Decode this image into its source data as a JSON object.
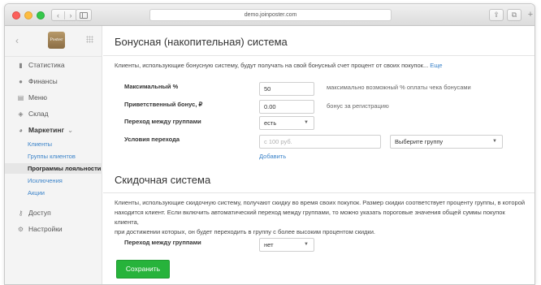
{
  "browser": {
    "url": "demo.joinposter.com",
    "nav_back": "‹",
    "nav_forward": "›",
    "share_glyph": "⇪",
    "tabs_glyph": "⧉",
    "new_tab_glyph": "+"
  },
  "sidebar": {
    "back_glyph": "‹",
    "logo_text": "Poster",
    "items": [
      {
        "label": "Статистика",
        "icon": "bar-chart-icon",
        "glyph": "▮"
      },
      {
        "label": "Финансы",
        "icon": "coin-icon",
        "glyph": "●"
      },
      {
        "label": "Меню",
        "icon": "document-icon",
        "glyph": "▤"
      },
      {
        "label": "Склад",
        "icon": "layers-icon",
        "glyph": "◈"
      },
      {
        "label": "Маркетинг",
        "icon": "pie-chart-icon",
        "glyph": "◕",
        "expanded_glyph": "⌄"
      },
      {
        "label": "Доступ",
        "icon": "key-icon",
        "glyph": "⚷"
      },
      {
        "label": "Настройки",
        "icon": "gear-icon",
        "glyph": "⚙"
      }
    ],
    "submenu": [
      {
        "label": "Клиенты"
      },
      {
        "label": "Группы клиентов"
      },
      {
        "label": "Программы лояльности",
        "active": true
      },
      {
        "label": "Исключения"
      },
      {
        "label": "Акции"
      }
    ]
  },
  "bonus": {
    "title": "Бонусная (накопительная) система",
    "description": "Клиенты, использующие бонусную систему, будут получать на свой бонусный счет процент от своих покупок...",
    "more_link": "Еще",
    "max_label": "Максимальный %",
    "max_value": "50",
    "max_hint": "максимально возможный % оплаты чека бонусами",
    "welcome_label": "Приветственный бонус, ₽",
    "welcome_value": "0.00",
    "welcome_hint": "бонус за регистрацию",
    "transition_label": "Переход между группами",
    "transition_value": "есть",
    "conditions_label": "Условия перехода",
    "amount_placeholder": "с 100 руб.",
    "group_select": "Выберите группу",
    "add_link": "Добавить"
  },
  "discount": {
    "title": "Скидочная система",
    "description_line1": "Клиенты, использующие скидочную систему, получают скидку во время своих покупок. Размер скидки соответствует проценту группы, в которой",
    "description_line2": "находится клиент. Если включить автоматический переход между группами, то можно указать пороговые значения общей суммы покупок клиента,",
    "description_line3": "при достижении которых, он будет переходить в группу с более высоким процентом скидки.",
    "transition_label": "Переход между группами",
    "transition_value": "нет"
  },
  "save_label": "Сохранить",
  "caret_glyph": "▼"
}
